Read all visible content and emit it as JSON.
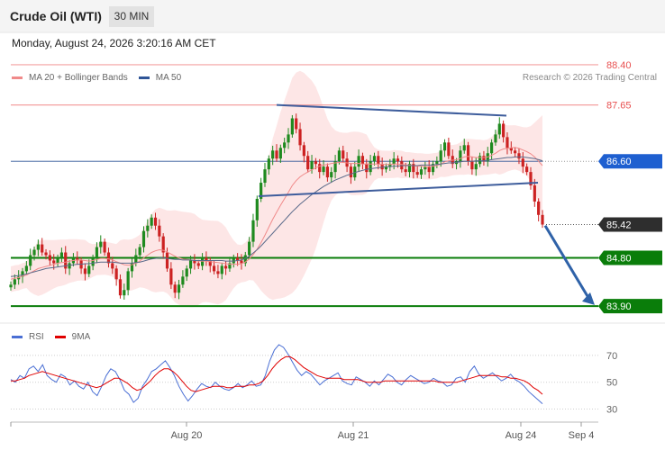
{
  "header": {
    "title": "Crude Oil (WTI)",
    "interval": "30 MIN"
  },
  "datetime": "Monday, August 24, 2026 3:20:16 AM CET",
  "legend": {
    "items": [
      {
        "label": "MA 20 + Bollinger Bands",
        "color": "#f08a8a"
      },
      {
        "label": "MA 50",
        "color": "#2f5597"
      }
    ],
    "credit": "Research © 2026 Trading Central"
  },
  "rsi_legend": {
    "items": [
      {
        "label": "RSI",
        "color": "#4a6fd4"
      },
      {
        "label": "9MA",
        "color": "#e00000"
      }
    ]
  },
  "colors": {
    "up": "#1f8a1f",
    "down": "#cc2222",
    "band_fill": "#fde3e3",
    "resistance": "#e85050",
    "support": "#0a7d0a",
    "pivot": "#1e5fd0",
    "last": "#2e2e2e",
    "trend": "#3e5d9c",
    "arrow": "#2f62a8"
  },
  "chart_data": [
    {
      "type": "candlestick",
      "title": "Crude Oil (WTI)",
      "interval": "30 MIN",
      "ylim": [
        83.6,
        88.6
      ],
      "x_ticks": [
        "Aug 20",
        "Aug 21",
        "Aug 24",
        "Sep 4"
      ],
      "levels": [
        {
          "value": 88.4,
          "label": "88.40",
          "kind": "resistance"
        },
        {
          "value": 87.65,
          "label": "87.65",
          "kind": "resistance"
        },
        {
          "value": 86.6,
          "label": "86.60",
          "kind": "pivot"
        },
        {
          "value": 85.42,
          "label": "85.42",
          "kind": "last"
        },
        {
          "value": 84.8,
          "label": "84.80",
          "kind": "support"
        },
        {
          "value": 83.9,
          "label": "83.90",
          "kind": "support"
        }
      ],
      "closes": [
        84.3,
        84.4,
        84.45,
        84.55,
        84.65,
        84.85,
        84.95,
        85.05,
        84.9,
        84.85,
        84.75,
        84.7,
        84.8,
        84.9,
        84.6,
        84.7,
        84.8,
        84.75,
        84.6,
        84.5,
        84.65,
        84.8,
        85.0,
        85.1,
        84.9,
        84.7,
        84.6,
        84.4,
        84.1,
        84.2,
        84.55,
        84.7,
        84.85,
        85.0,
        85.3,
        85.4,
        85.55,
        85.4,
        85.2,
        84.9,
        84.6,
        84.3,
        84.15,
        84.3,
        84.45,
        84.6,
        84.75,
        84.7,
        84.65,
        84.8,
        84.75,
        84.65,
        84.55,
        84.5,
        84.65,
        84.6,
        84.7,
        84.8,
        84.75,
        84.7,
        84.85,
        85.1,
        85.5,
        85.9,
        86.2,
        86.45,
        86.65,
        86.8,
        86.65,
        86.85,
        86.95,
        87.1,
        87.4,
        87.2,
        86.9,
        86.7,
        86.45,
        86.6,
        86.55,
        86.4,
        86.5,
        86.3,
        86.4,
        86.6,
        86.8,
        86.65,
        86.5,
        86.3,
        86.5,
        86.7,
        86.55,
        86.4,
        86.6,
        86.7,
        86.55,
        86.45,
        86.5,
        86.55,
        86.65,
        86.6,
        86.45,
        86.4,
        86.55,
        86.4,
        86.35,
        86.45,
        86.5,
        86.4,
        86.55,
        86.6,
        86.8,
        86.95,
        86.7,
        86.55,
        86.6,
        86.8,
        86.9,
        86.6,
        86.45,
        86.55,
        86.7,
        86.6,
        86.75,
        86.95,
        87.1,
        87.3,
        87.05,
        86.85,
        86.8,
        86.75,
        86.65,
        86.5,
        86.4,
        86.15,
        85.85,
        85.6,
        85.42
      ],
      "ma20": [
        84.4,
        84.42,
        84.43,
        84.46,
        84.48,
        84.52,
        84.56,
        84.6,
        84.62,
        84.64,
        84.66,
        84.68,
        84.7,
        84.71,
        84.72,
        84.74,
        84.75,
        84.76,
        84.76,
        84.75,
        84.74,
        84.75,
        84.77,
        84.79,
        84.79,
        84.78,
        84.76,
        84.73,
        84.7,
        84.67,
        84.66,
        84.67,
        84.7,
        84.74,
        84.8,
        84.85,
        84.9,
        84.93,
        84.95,
        84.94,
        84.91,
        84.87,
        84.83,
        84.8,
        84.78,
        84.77,
        84.76,
        84.75,
        84.74,
        84.74,
        84.74,
        84.73,
        84.72,
        84.71,
        84.7,
        84.69,
        84.68,
        84.68,
        84.68,
        84.69,
        84.72,
        84.78,
        84.86,
        84.96,
        85.08,
        85.22,
        85.37,
        85.52,
        85.65,
        85.78,
        85.9,
        86.02,
        86.15,
        86.24,
        86.31,
        86.36,
        86.4,
        86.44,
        86.48,
        86.51,
        86.53,
        86.54,
        86.56,
        86.57,
        86.58,
        86.58,
        86.57,
        86.56,
        86.56,
        86.56,
        86.55,
        86.55,
        86.55,
        86.55,
        86.55,
        86.54,
        86.54,
        86.54,
        86.55,
        86.55,
        86.54,
        86.53,
        86.53,
        86.52,
        86.51,
        86.51,
        86.5,
        86.5,
        86.51,
        86.52,
        86.55,
        86.59,
        86.61,
        86.62,
        86.63,
        86.65,
        86.68,
        86.69,
        86.68,
        86.67,
        86.67,
        86.67,
        86.68,
        86.71,
        86.75,
        86.8,
        86.83,
        86.84,
        86.85,
        86.86,
        86.84,
        86.81,
        86.78,
        86.74,
        86.68,
        86.6,
        86.52
      ],
      "ma50": [
        84.45,
        84.46,
        84.47,
        84.48,
        84.5,
        84.52,
        84.54,
        84.56,
        84.58,
        84.6,
        84.61,
        84.62,
        84.63,
        84.64,
        84.65,
        84.66,
        84.67,
        84.68,
        84.68,
        84.69,
        84.69,
        84.7,
        84.71,
        84.72,
        84.72,
        84.72,
        84.72,
        84.71,
        84.7,
        84.7,
        84.7,
        84.7,
        84.71,
        84.72,
        84.74,
        84.76,
        84.78,
        84.79,
        84.8,
        84.8,
        84.79,
        84.78,
        84.77,
        84.77,
        84.76,
        84.76,
        84.76,
        84.75,
        84.75,
        84.75,
        84.75,
        84.75,
        84.75,
        84.75,
        84.75,
        84.74,
        84.74,
        84.74,
        84.75,
        84.76,
        84.79,
        84.83,
        84.89,
        84.95,
        85.02,
        85.1,
        85.18,
        85.26,
        85.34,
        85.42,
        85.5,
        85.58,
        85.66,
        85.73,
        85.8,
        85.86,
        85.92,
        85.98,
        86.03,
        86.08,
        86.13,
        86.17,
        86.21,
        86.25,
        86.28,
        86.31,
        86.34,
        86.36,
        86.39,
        86.41,
        86.43,
        86.45,
        86.46,
        86.47,
        86.48,
        86.49,
        86.5,
        86.5,
        86.51,
        86.51,
        86.52,
        86.52,
        86.52,
        86.52,
        86.52,
        86.53,
        86.53,
        86.53,
        86.53,
        86.54,
        86.55,
        86.56,
        86.57,
        86.57,
        86.58,
        86.59,
        86.6,
        86.6,
        86.6,
        86.61,
        86.61,
        86.61,
        86.62,
        86.63,
        86.64,
        86.65,
        86.66,
        86.67,
        86.67,
        86.68,
        86.68,
        86.68,
        86.67,
        86.66,
        86.65,
        86.63,
        86.61
      ],
      "trendlines": [
        {
          "from": [
            0.0,
            84.3
          ],
          "to": [
            0.0,
            84.3
          ],
          "name": ""
        }
      ]
    },
    {
      "type": "line",
      "ylim": [
        25,
        80
      ],
      "y_ticks": [
        30,
        50,
        70
      ],
      "series": [
        {
          "name": "RSI",
          "values": [
            52,
            50,
            55,
            53,
            60,
            62,
            58,
            63,
            55,
            52,
            50,
            56,
            54,
            48,
            51,
            47,
            45,
            50,
            43,
            40,
            47,
            55,
            60,
            58,
            52,
            44,
            41,
            35,
            38,
            47,
            52,
            58,
            60,
            63,
            66,
            61,
            55,
            47,
            41,
            36,
            40,
            45,
            49,
            47,
            46,
            50,
            47,
            45,
            44,
            46,
            49,
            46,
            48,
            51,
            47,
            48,
            55,
            66,
            74,
            78,
            76,
            71,
            65,
            59,
            55,
            58,
            56,
            52,
            48,
            51,
            53,
            55,
            57,
            51,
            49,
            48,
            54,
            52,
            50,
            47,
            51,
            48,
            52,
            56,
            54,
            50,
            48,
            52,
            55,
            53,
            51,
            49,
            50,
            53,
            51,
            50,
            47,
            48,
            53,
            54,
            50,
            58,
            62,
            56,
            53,
            55,
            57,
            54,
            51,
            53,
            56,
            52,
            50,
            47,
            43,
            40,
            37,
            34
          ]
        },
        {
          "name": "9MA",
          "values": [
            51,
            51,
            52,
            53,
            55,
            56,
            57,
            58,
            57,
            56,
            55,
            54,
            53,
            52,
            51,
            50,
            49,
            48,
            47,
            46,
            47,
            49,
            51,
            53,
            53,
            51,
            49,
            46,
            44,
            45,
            48,
            51,
            55,
            58,
            60,
            60,
            58,
            55,
            51,
            47,
            44,
            43,
            44,
            45,
            46,
            47,
            47,
            47,
            46,
            46,
            47,
            47,
            47,
            48,
            48,
            49,
            51,
            55,
            60,
            64,
            67,
            69,
            69,
            67,
            64,
            61,
            59,
            57,
            55,
            54,
            53,
            53,
            53,
            53,
            52,
            52,
            52,
            52,
            51,
            50,
            50,
            50,
            50,
            51,
            51,
            51,
            51,
            51,
            51,
            51,
            51,
            51,
            51,
            51,
            51,
            50,
            50,
            50,
            50,
            50,
            51,
            52,
            53,
            54,
            55,
            55,
            55,
            55,
            55,
            54,
            54,
            53,
            53,
            52,
            51,
            49,
            46,
            44,
            41
          ]
        }
      ]
    }
  ]
}
